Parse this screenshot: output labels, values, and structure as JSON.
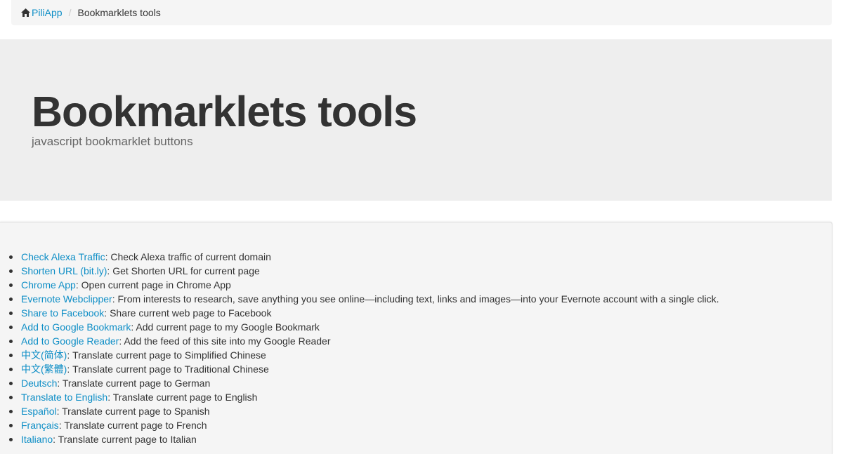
{
  "breadcrumb": {
    "home_label": "PiliApp",
    "current": "Bookmarklets tools"
  },
  "header": {
    "title": "Bookmarklets tools",
    "subtitle": "javascript bookmarklet buttons"
  },
  "bookmarklets": [
    {
      "name": "Check Alexa Traffic",
      "description": ": Check Alexa traffic of current domain"
    },
    {
      "name": "Shorten URL (bit.ly)",
      "description": ": Get Shorten URL for current page"
    },
    {
      "name": "Chrome App",
      "description": ": Open current page in Chrome App"
    },
    {
      "name": "Evernote Webclipper",
      "description": ": From interests to research, save anything you see online—including text, links and images—into your Evernote account with a single click."
    },
    {
      "name": "Share to Facebook",
      "description": ": Share current web page to Facebook"
    },
    {
      "name": "Add to Google Bookmark",
      "description": ": Add current page to my Google Bookmark"
    },
    {
      "name": "Add to Google Reader",
      "description": ": Add the feed of this site into my Google Reader"
    },
    {
      "name": "中文(简体)",
      "description": ": Translate current page to Simplified Chinese"
    },
    {
      "name": "中文(繁體)",
      "description": ": Translate current page to Traditional Chinese"
    },
    {
      "name": "Deutsch",
      "description": ": Translate current page to German"
    },
    {
      "name": "Translate to English",
      "description": ": Translate current page to English"
    },
    {
      "name": "Español",
      "description": ": Translate current page to Spanish"
    },
    {
      "name": "Français",
      "description": ": Translate current page to French"
    },
    {
      "name": "Italiano",
      "description": ": Translate current page to Italian"
    }
  ],
  "colors": {
    "link": "#0e8ec6",
    "text": "#333333",
    "jumbotron_bg": "#eeeeee",
    "breadcrumb_bg": "#f5f5f5"
  },
  "icons": {
    "home": "home-icon"
  }
}
